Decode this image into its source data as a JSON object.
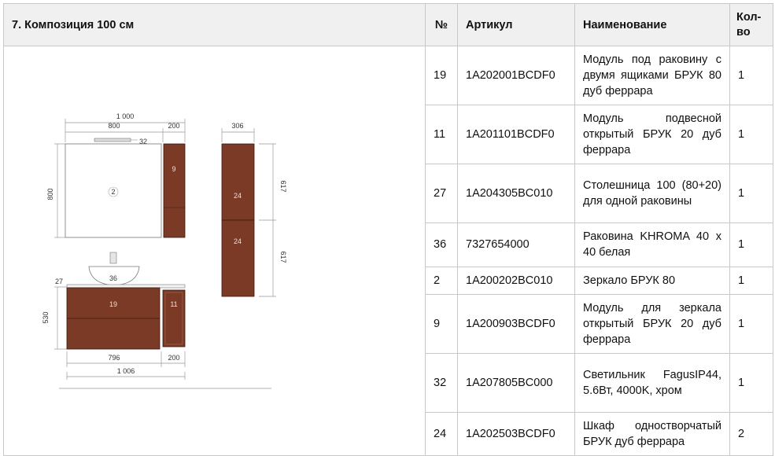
{
  "header": {
    "title": "7. Композиция 100 см",
    "col_no": "№",
    "col_article": "Артикул",
    "col_name": "Наименование",
    "col_qty": "Кол-во"
  },
  "rows": [
    {
      "no": "19",
      "article": "1A202001BCDF0",
      "name": "Модуль под раковину с двумя ящиками БРУК 80 дуб феррара",
      "qty": "1"
    },
    {
      "no": "11",
      "article": "1A201101BCDF0",
      "name": "Модуль подвесной открытый БРУК 20 дуб феррара",
      "qty": "1"
    },
    {
      "no": "27",
      "article": "1A204305BC010",
      "name": "Столешница 100 (80+20) для одной раковины",
      "qty": "1"
    },
    {
      "no": "36",
      "article": "7327654000",
      "name": "Раковина KHROMA 40 x 40 белая",
      "qty": "1"
    },
    {
      "no": "2",
      "article": "1A200202BC010",
      "name": "Зеркало БРУК 80",
      "qty": "1"
    },
    {
      "no": "9",
      "article": "1A200903BCDF0",
      "name": "Модуль для зеркала открытый БРУК 20 дуб феррара",
      "qty": "1"
    },
    {
      "no": "32",
      "article": "1A207805BC000",
      "name": "Светильник FagusIP44, 5.6Вт, 4000K, хром",
      "qty": "1"
    },
    {
      "no": "24",
      "article": "1A202503BCDF0",
      "name": "Шкаф одностворчатый БРУК дуб феррара",
      "qty": "2"
    }
  ],
  "drawing": {
    "dim_total_top": "1 000",
    "dim_mirror_w": "800",
    "dim_module_w_top": "200",
    "dim_cabinet_w": "306",
    "dim_mirror_h": "800",
    "dim_cab_h_upper": "617",
    "dim_cab_h_lower": "617",
    "dim_counter_th": "27",
    "dim_base_h": "530",
    "dim_base_w": "796",
    "dim_module_w_bottom": "200",
    "dim_total_bottom": "1 006",
    "tag_lamp": "32",
    "tag_mirror": "2",
    "tag_mirror_module": "9",
    "tag_cab_upper": "24",
    "tag_cab_lower": "24",
    "tag_sink": "36",
    "tag_base": "19",
    "tag_side_module": "11"
  },
  "colors": {
    "wood": "#7a3a25",
    "wood_edge": "#3a1a10",
    "header_bg": "#f0f0f0",
    "border": "#c8c8c8"
  }
}
